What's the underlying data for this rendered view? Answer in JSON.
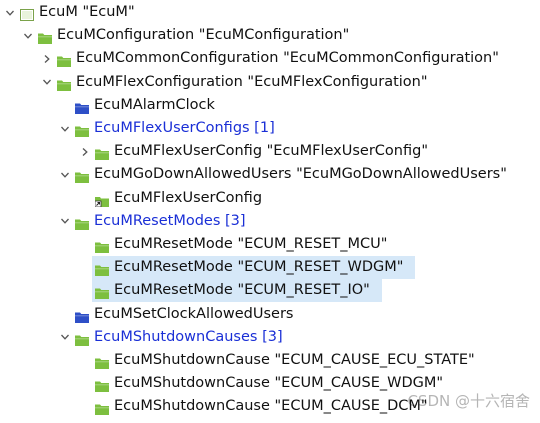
{
  "tree": {
    "rows": [
      {
        "text": "EcuM \"EcuM\"",
        "depth": 0,
        "toggle": "expanded",
        "icon": "module-open-icon",
        "link": false,
        "selected": false
      },
      {
        "text": "EcuMConfiguration \"EcuMConfiguration\"",
        "depth": 1,
        "toggle": "expanded",
        "icon": "container-icon",
        "link": false,
        "selected": false
      },
      {
        "text": "EcuMCommonConfiguration \"EcuMCommonConfiguration\"",
        "depth": 2,
        "toggle": "collapsed",
        "icon": "container-icon",
        "link": false,
        "selected": false
      },
      {
        "text": "EcuMFlexConfiguration \"EcuMFlexConfiguration\"",
        "depth": 2,
        "toggle": "expanded",
        "icon": "container-icon",
        "link": false,
        "selected": false
      },
      {
        "text": "EcuMAlarmClock",
        "depth": 3,
        "toggle": "none",
        "icon": "empty-container-icon",
        "link": false,
        "selected": false
      },
      {
        "text": "EcuMFlexUserConfigs [1]",
        "depth": 3,
        "toggle": "expanded",
        "icon": "container-icon",
        "link": true,
        "selected": false
      },
      {
        "text": "EcuMFlexUserConfig \"EcuMFlexUserConfig\"",
        "depth": 4,
        "toggle": "collapsed",
        "icon": "container-icon",
        "link": false,
        "selected": false
      },
      {
        "text": "EcuMGoDownAllowedUsers \"EcuMGoDownAllowedUsers\"",
        "depth": 3,
        "toggle": "expanded",
        "icon": "container-icon",
        "link": false,
        "selected": false
      },
      {
        "text": "EcuMFlexUserConfig",
        "depth": 4,
        "toggle": "none",
        "icon": "reference-icon",
        "link": false,
        "selected": false
      },
      {
        "text": "EcuMResetModes [3]",
        "depth": 3,
        "toggle": "expanded",
        "icon": "container-icon",
        "link": true,
        "selected": false
      },
      {
        "text": "EcuMResetMode \"ECUM_RESET_MCU\"",
        "depth": 4,
        "toggle": "none",
        "icon": "container-icon",
        "link": false,
        "selected": false
      },
      {
        "text": "EcuMResetMode \"ECUM_RESET_WDGM\"",
        "depth": 4,
        "toggle": "none",
        "icon": "container-icon",
        "link": false,
        "selected": true
      },
      {
        "text": "EcuMResetMode \"ECUM_RESET_IO\"",
        "depth": 4,
        "toggle": "none",
        "icon": "container-icon",
        "link": false,
        "selected": true
      },
      {
        "text": "EcuMSetClockAllowedUsers",
        "depth": 3,
        "toggle": "none",
        "icon": "empty-container-icon",
        "link": false,
        "selected": false
      },
      {
        "text": "EcuMShutdownCauses [3]",
        "depth": 3,
        "toggle": "expanded",
        "icon": "container-icon",
        "link": true,
        "selected": false
      },
      {
        "text": "EcuMShutdownCause \"ECUM_CAUSE_ECU_STATE\"",
        "depth": 4,
        "toggle": "none",
        "icon": "container-icon",
        "link": false,
        "selected": false
      },
      {
        "text": "EcuMShutdownCause \"ECUM_CAUSE_WDGM\"",
        "depth": 4,
        "toggle": "none",
        "icon": "container-icon",
        "link": false,
        "selected": false
      },
      {
        "text": "EcuMShutdownCause \"ECUM_CAUSE_DCM\"",
        "depth": 4,
        "toggle": "none",
        "icon": "container-icon",
        "link": false,
        "selected": false
      }
    ]
  },
  "watermark": "CSDN @十六宿舍",
  "colors": {
    "container": "#7dbf3f",
    "empty_container": "#2e4fc7",
    "link_text": "#1a2fd6",
    "selection": "#d6e8f8"
  }
}
